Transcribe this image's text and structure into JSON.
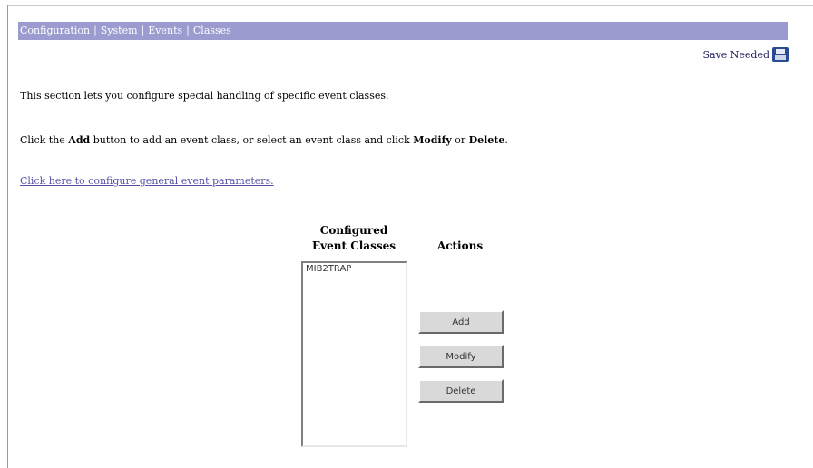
{
  "breadcrumb": {
    "items": [
      "Configuration",
      "System",
      "Events",
      "Classes"
    ],
    "separator": "|"
  },
  "save_needed": {
    "label": "Save Needed",
    "icon": "floppy-disk-icon"
  },
  "intro": {
    "line1": "This section lets you configure special handling of specific event classes.",
    "line2_a": "Click the ",
    "line2_add": "Add",
    "line2_b": " button to add an event class, or select an event class and click ",
    "line2_modify": "Modify",
    "line2_c": " or ",
    "line2_delete": "Delete",
    "line2_d": ".",
    "link": "Click here to configure general event parameters."
  },
  "table": {
    "classes_header_line1": "Configured",
    "classes_header_line2": "Event Classes",
    "actions_header": "Actions",
    "classes": [
      "MIB2TRAP"
    ]
  },
  "buttons": {
    "add": "Add",
    "modify": "Modify",
    "delete": "Delete"
  },
  "colors": {
    "header_bar": "#9b9bd0",
    "link": "#5552a6"
  }
}
